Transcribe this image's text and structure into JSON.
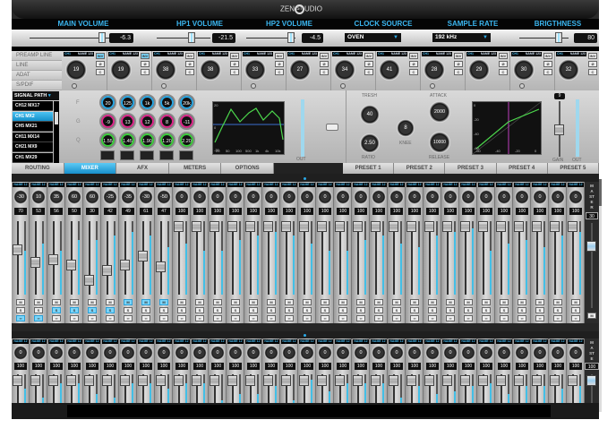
{
  "app": {
    "logo": "ZENSTUDIO"
  },
  "top": {
    "labels": [
      "MAIN VOLUME",
      "HP1 VOLUME",
      "HP2 VOLUME",
      "CLOCK SOURCE",
      "SAMPLE RATE",
      "BRIGTHNESS"
    ],
    "main_volume": {
      "value": "-6.3",
      "level": 0.85
    },
    "hp1_volume": {
      "value": "-21.5",
      "level": 0.65
    },
    "hp2_volume": {
      "value": "-4.5",
      "level": 0.9
    },
    "clock_source": "OVEN",
    "sample_rate": "192 kHz",
    "brightness": {
      "value": "80",
      "level": 0.8
    }
  },
  "inputs": {
    "sources": [
      "PREAMP LINE",
      "LINE",
      "ADAT",
      "S/PDIF"
    ],
    "strip_label": "CH1",
    "strip_name": "NAME 123",
    "gains": [
      "19",
      "19",
      "38",
      "38",
      "33",
      "27",
      "34",
      "41",
      "28",
      "29",
      "30",
      "32"
    ],
    "buttons": [
      "INV",
      "Ø",
      "C"
    ]
  },
  "signal_path": {
    "label": "SIGNAL PATH",
    "items": [
      "CH12 MX17",
      "CH1 MX2",
      "CH5 MX21",
      "CH11 MX14",
      "CH21 MX9",
      "CH1 MX29"
    ],
    "selected": 1
  },
  "eq": {
    "rows": [
      "F",
      "G",
      "Q"
    ],
    "F": [
      "20",
      "125",
      "1k",
      "5k",
      "20k"
    ],
    "G": [
      "-9",
      "13",
      "12",
      "8",
      "-11"
    ],
    "Q": [
      "1.55",
      "1.45",
      "1.90",
      "1.20",
      "2.20"
    ],
    "colors": {
      "F": "#2aa9e6",
      "G": "#e0288c",
      "Q": "#3ccf3c"
    },
    "graph_y": [
      "20",
      "0",
      "-20"
    ],
    "graph_x": [
      "20",
      "50",
      "100",
      "500",
      "1k",
      "4k",
      "10k"
    ],
    "out_label": "OUT"
  },
  "comp": {
    "tresh_label": "TRESH",
    "tresh": "40",
    "ratio_label": "RATIO",
    "ratio": "2.50",
    "knee_label": "KNEE",
    "knee": "8",
    "attack_label": "ATTACK",
    "attack": "2000",
    "release_label": "RELEASE",
    "release": "10000",
    "graph_y": [
      "0",
      "-20",
      "-40",
      "-60"
    ],
    "graph_x": [
      "-60",
      "-40",
      "-20",
      "0"
    ],
    "gain": "9",
    "gain_label": "GAIN",
    "out_label": "OUT"
  },
  "tabs": [
    "ROUTING",
    "MIXER",
    "AFX",
    "METERS",
    "OPTIONS"
  ],
  "active_tab": "MIXER",
  "presets": [
    "PRESET 1",
    "PRESET 2",
    "PRESET 3",
    "PRESET 4",
    "PRESET 5"
  ],
  "mixer": {
    "channel_name": "NAME 12",
    "buttons": [
      "M",
      "S",
      "∞"
    ],
    "pans": [
      "-30",
      "10",
      "35",
      "60",
      "60",
      "-25",
      "-35",
      "-30",
      "-50",
      "0",
      "0",
      "0",
      "0",
      "0",
      "0",
      "0",
      "0",
      "0",
      "0",
      "0",
      "0",
      "0",
      "0",
      "0",
      "0",
      "0",
      "0",
      "0",
      "0",
      "0",
      "0",
      "0"
    ],
    "volumes": [
      "70",
      "53",
      "56",
      "50",
      "30",
      "42",
      "49",
      "61",
      "47",
      "100",
      "100",
      "100",
      "100",
      "100",
      "100",
      "100",
      "100",
      "100",
      "100",
      "100",
      "100",
      "100",
      "100",
      "100",
      "100",
      "100",
      "100",
      "100",
      "100",
      "100",
      "100",
      "100"
    ],
    "mute_on": [
      7,
      8,
      9
    ],
    "solo_on": [
      3,
      4,
      5,
      6
    ],
    "link_on": [
      1,
      2
    ],
    "meters": [
      0.6,
      0.7,
      0.6,
      0.75,
      0.75,
      0.8,
      0.85,
      0.8,
      0.65,
      0.7,
      0.6,
      0.6,
      0.75,
      0.8,
      0.85,
      0.8,
      0.7,
      0.6,
      0.6,
      0.75,
      0.8,
      0.7,
      0.65,
      0.8,
      0.85,
      0.9,
      0.6,
      0.7,
      0.75,
      0.65,
      0.8,
      0.85
    ],
    "master_label": "MASTER",
    "master_value": "30"
  },
  "mixer2": {
    "channel_name": "NAME 12",
    "pan": "0",
    "volume": "100",
    "meters": [
      0.5,
      0.2,
      0.7,
      0.7,
      0.3,
      0.2,
      0.7,
      0.7,
      0.5,
      0.7,
      0.7,
      0.1,
      0.3,
      0.3,
      0.6,
      0.1,
      0.8,
      0.4,
      0.7,
      0.7,
      0.7,
      0.2,
      0.6,
      0.3,
      0.4,
      0.6,
      0.7,
      0.3,
      0.6,
      0.6,
      0.5,
      0.6
    ],
    "master_label": "MASTER",
    "master_value": "100"
  }
}
